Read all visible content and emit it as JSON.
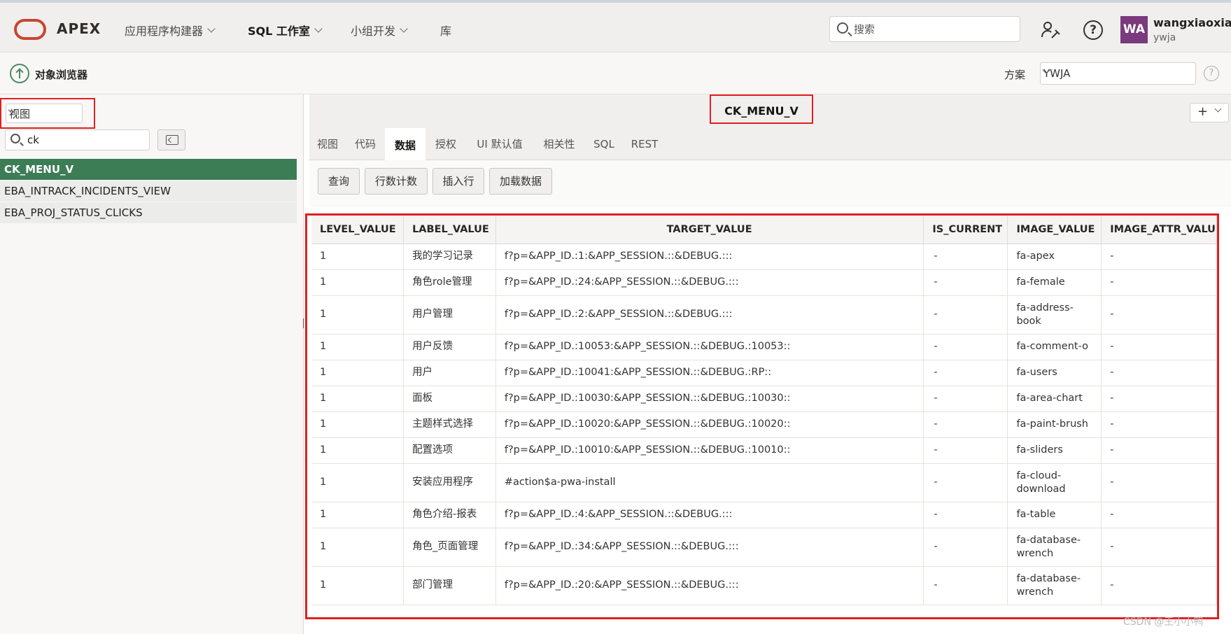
{
  "header": {
    "brand": "APEX",
    "nav": [
      {
        "label": "应用程序构建器",
        "has_menu": true,
        "active": false
      },
      {
        "label": "SQL 工作室",
        "has_menu": true,
        "active": true
      },
      {
        "label": "小组开发",
        "has_menu": true,
        "active": false
      },
      {
        "label": "库",
        "has_menu": false,
        "active": false
      }
    ],
    "search_placeholder": "搜索",
    "user_initials": "WA",
    "user_name": "wangxiaoxian",
    "user_schema": "ywja"
  },
  "subbar": {
    "title": "对象浏览器",
    "schema_label": "方案",
    "schema_value": "YWJA"
  },
  "left": {
    "object_type": "视图",
    "filter_value": "ck",
    "objects": [
      "CK_MENU_V",
      "EBA_INTRACK_INCIDENTS_VIEW",
      "EBA_PROJ_STATUS_CLICKS"
    ],
    "selected_index": 0
  },
  "right": {
    "object_name": "CK_MENU_V",
    "add_label": "+",
    "tabs": [
      "视图",
      "代码",
      "数据",
      "授权",
      "UI 默认值",
      "相关性",
      "SQL",
      "REST"
    ],
    "active_tab": 2,
    "actions": [
      "查询",
      "行数计数",
      "插入行",
      "加载数据"
    ],
    "grid": {
      "columns": [
        "LEVEL_VALUE",
        "LABEL_VALUE",
        "TARGET_VALUE",
        "IS_CURRENT",
        "IMAGE_VALUE",
        "IMAGE_ATTR_VALU"
      ],
      "rows": [
        [
          "1",
          "我的学习记录",
          "f?p=&APP_ID.:1:&APP_SESSION.::&DEBUG.:::",
          "-",
          "fa-apex",
          "-"
        ],
        [
          "1",
          "角色role管理",
          "f?p=&APP_ID.:24:&APP_SESSION.::&DEBUG.:::",
          "-",
          "fa-female",
          "-"
        ],
        [
          "1",
          "用户管理",
          "f?p=&APP_ID.:2:&APP_SESSION.::&DEBUG.:::",
          "-",
          "fa-address-book",
          "-"
        ],
        [
          "1",
          "用户反馈",
          "f?p=&APP_ID.:10053:&APP_SESSION.::&DEBUG.:10053::",
          "-",
          "fa-comment-o",
          "-"
        ],
        [
          "1",
          "用户",
          "f?p=&APP_ID.:10041:&APP_SESSION.::&DEBUG.:RP::",
          "-",
          "fa-users",
          "-"
        ],
        [
          "1",
          "面板",
          "f?p=&APP_ID.:10030:&APP_SESSION.::&DEBUG.:10030::",
          "-",
          "fa-area-chart",
          "-"
        ],
        [
          "1",
          "主题样式选择",
          "f?p=&APP_ID.:10020:&APP_SESSION.::&DEBUG.:10020::",
          "-",
          "fa-paint-brush",
          "-"
        ],
        [
          "1",
          "配置选项",
          "f?p=&APP_ID.:10010:&APP_SESSION.::&DEBUG.:10010::",
          "-",
          "fa-sliders",
          "-"
        ],
        [
          "1",
          "安装应用程序",
          "#action$a-pwa-install",
          "-",
          "fa-cloud-download",
          "-"
        ],
        [
          "1",
          "角色介绍-报表",
          "f?p=&APP_ID.:4:&APP_SESSION.::&DEBUG.:::",
          "-",
          "fa-table",
          "-"
        ],
        [
          "1",
          "角色_页面管理",
          "f?p=&APP_ID.:34:&APP_SESSION.::&DEBUG.:::",
          "-",
          "fa-database-wrench",
          "-"
        ],
        [
          "1",
          "部门管理",
          "f?p=&APP_ID.:20:&APP_SESSION.::&DEBUG.:::",
          "-",
          "fa-database-wrench",
          "-"
        ]
      ]
    }
  },
  "watermark": "CSDN @王小小鸭",
  "colors": {
    "accent_green": "#3c7d55",
    "highlight_red": "#e02020",
    "oracle_red": "#c74634",
    "avatar": "#7b3a7d"
  },
  "icons": [
    "oracle-logo-icon",
    "search-icon",
    "user-help-icon",
    "help-icon",
    "up-arrow-icon",
    "reset-filter-icon",
    "chevron-down-icon"
  ]
}
